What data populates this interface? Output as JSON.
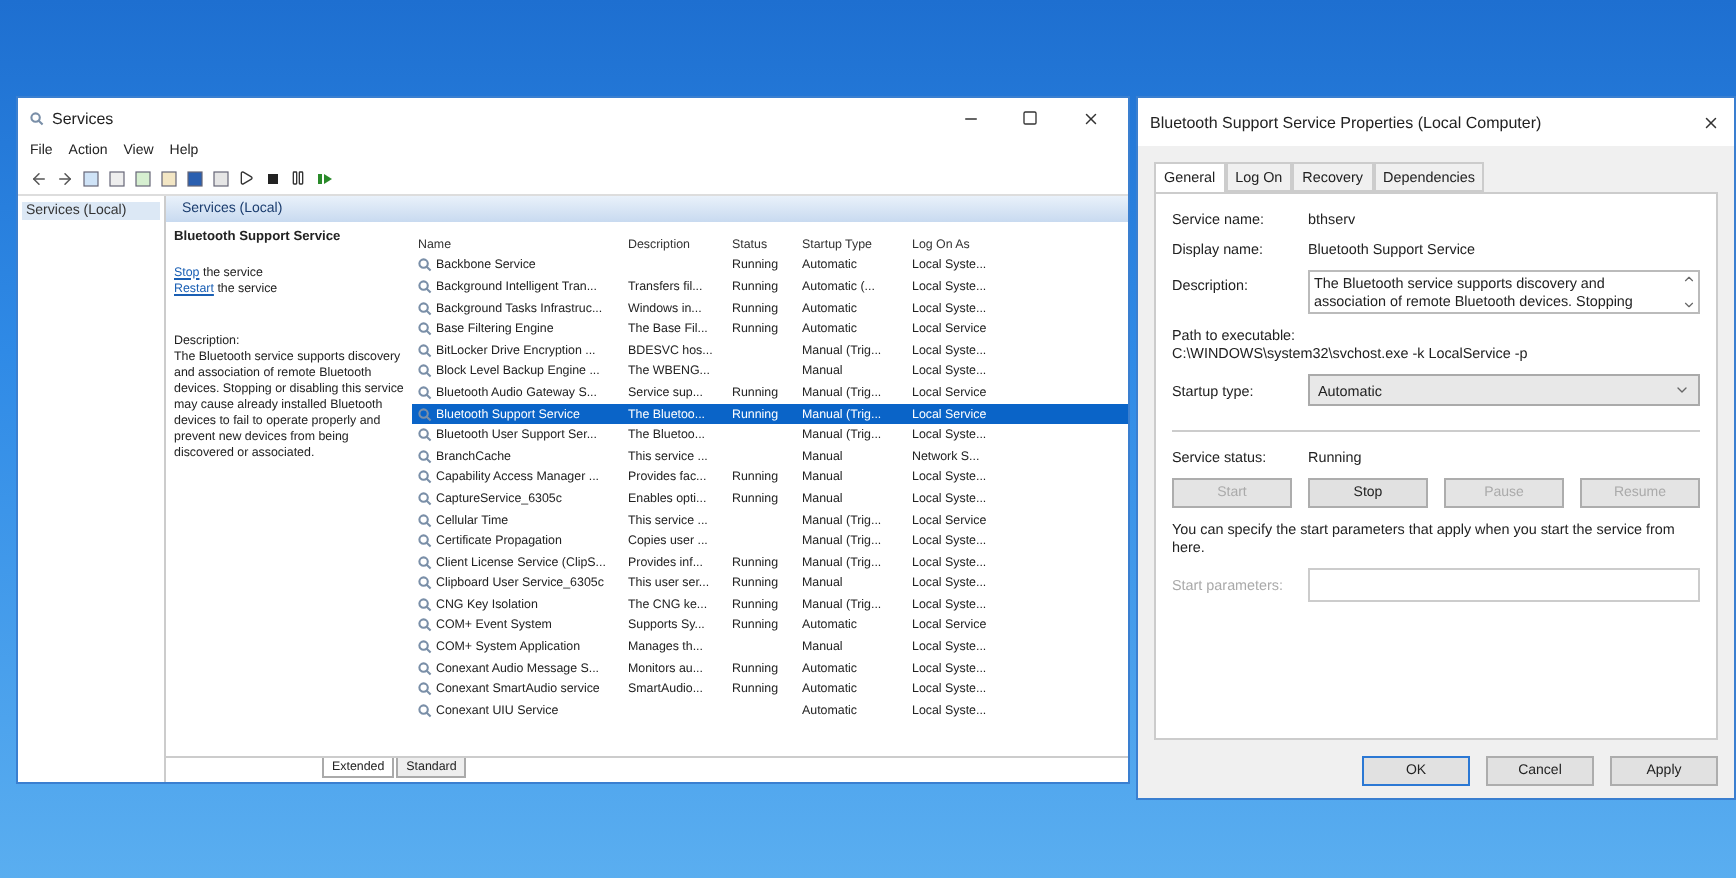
{
  "services_window": {
    "title": "Services",
    "menu": [
      "File",
      "Action",
      "View",
      "Help"
    ],
    "tree": [
      {
        "label": "Services (Local)",
        "selected": true
      }
    ],
    "header": "Services (Local)",
    "extended": {
      "service_title": "Bluetooth Support Service",
      "actions": [
        {
          "link": "Stop",
          "text": "the service"
        },
        {
          "link": "Restart",
          "text": "the service"
        }
      ],
      "description_label": "Description:",
      "description": "The Bluetooth service supports discovery and association of remote Bluetooth devices.  Stopping or disabling this service may cause already installed Bluetooth devices to fail to operate properly and prevent new devices from being discovered or associated."
    },
    "columns": [
      "Name",
      "Description",
      "Status",
      "Startup Type",
      "Log On As"
    ],
    "rows": [
      {
        "cells": [
          "Backbone Service",
          "",
          "Running",
          "Automatic",
          "Local Syste..."
        ],
        "selected": false
      },
      {
        "cells": [
          "Background Intelligent Tran...",
          "Transfers fil...",
          "Running",
          "Automatic (...",
          "Local Syste..."
        ],
        "selected": false
      },
      {
        "cells": [
          "Background Tasks Infrastruc...",
          "Windows in...",
          "Running",
          "Automatic",
          "Local Syste..."
        ],
        "selected": false
      },
      {
        "cells": [
          "Base Filtering Engine",
          "The Base Fil...",
          "Running",
          "Automatic",
          "Local Service"
        ],
        "selected": false
      },
      {
        "cells": [
          "BitLocker Drive Encryption ...",
          "BDESVC hos...",
          "",
          "Manual (Trig...",
          "Local Syste..."
        ],
        "selected": false
      },
      {
        "cells": [
          "Block Level Backup Engine ...",
          "The WBENG...",
          "",
          "Manual",
          "Local Syste..."
        ],
        "selected": false
      },
      {
        "cells": [
          "Bluetooth Audio Gateway S...",
          "Service sup...",
          "Running",
          "Manual (Trig...",
          "Local Service"
        ],
        "selected": false
      },
      {
        "cells": [
          "Bluetooth Support Service",
          "The Bluetoo...",
          "Running",
          "Manual (Trig...",
          "Local Service"
        ],
        "selected": true
      },
      {
        "cells": [
          "Bluetooth User Support Ser...",
          "The Bluetoo...",
          "",
          "Manual (Trig...",
          "Local Syste..."
        ],
        "selected": false
      },
      {
        "cells": [
          "BranchCache",
          "This service ...",
          "",
          "Manual",
          "Network S..."
        ],
        "selected": false
      },
      {
        "cells": [
          "Capability Access Manager ...",
          "Provides fac...",
          "Running",
          "Manual",
          "Local Syste..."
        ],
        "selected": false
      },
      {
        "cells": [
          "CaptureService_6305c",
          "Enables opti...",
          "Running",
          "Manual",
          "Local Syste..."
        ],
        "selected": false
      },
      {
        "cells": [
          "Cellular Time",
          "This service ...",
          "",
          "Manual (Trig...",
          "Local Service"
        ],
        "selected": false
      },
      {
        "cells": [
          "Certificate Propagation",
          "Copies user ...",
          "",
          "Manual (Trig...",
          "Local Syste..."
        ],
        "selected": false
      },
      {
        "cells": [
          "Client License Service (ClipS...",
          "Provides inf...",
          "Running",
          "Manual (Trig...",
          "Local Syste..."
        ],
        "selected": false
      },
      {
        "cells": [
          "Clipboard User Service_6305c",
          "This user ser...",
          "Running",
          "Manual",
          "Local Syste..."
        ],
        "selected": false
      },
      {
        "cells": [
          "CNG Key Isolation",
          "The CNG ke...",
          "Running",
          "Manual (Trig...",
          "Local Syste..."
        ],
        "selected": false
      },
      {
        "cells": [
          "COM+ Event System",
          "Supports Sy...",
          "Running",
          "Automatic",
          "Local Service"
        ],
        "selected": false
      },
      {
        "cells": [
          "COM+ System Application",
          "Manages th...",
          "",
          "Manual",
          "Local Syste..."
        ],
        "selected": false
      },
      {
        "cells": [
          "Conexant Audio Message S...",
          "Monitors au...",
          "Running",
          "Automatic",
          "Local Syste..."
        ],
        "selected": false
      },
      {
        "cells": [
          "Conexant SmartAudio service",
          "SmartAudio...",
          "Running",
          "Automatic",
          "Local Syste..."
        ],
        "selected": false
      },
      {
        "cells": [
          "Conexant UIU Service",
          "",
          "",
          "Automatic",
          "Local Syste..."
        ],
        "selected": false
      }
    ],
    "view_tabs": [
      {
        "label": "Extended",
        "selected": true
      },
      {
        "label": "Standard",
        "selected": false
      }
    ]
  },
  "properties_window": {
    "title": "Bluetooth Support Service Properties (Local Computer)",
    "tabs": [
      {
        "label": "General",
        "selected": true
      },
      {
        "label": "Log On",
        "selected": false
      },
      {
        "label": "Recovery",
        "selected": false
      },
      {
        "label": "Dependencies",
        "selected": false
      }
    ],
    "service_name_label": "Service name:",
    "service_name": "bthserv",
    "display_name_label": "Display name:",
    "display_name": "Bluetooth Support Service",
    "description_label": "Description:",
    "description": "The Bluetooth service supports discovery and association of remote Bluetooth devices.  Stopping",
    "path_label": "Path to executable:",
    "path": "C:\\WINDOWS\\system32\\svchost.exe -k LocalService -p",
    "startup_label": "Startup type:",
    "startup_value": "Automatic",
    "status_label": "Service status:",
    "status_value": "Running",
    "control_buttons": [
      {
        "label": "Start",
        "disabled": true
      },
      {
        "label": "Stop",
        "disabled": false
      },
      {
        "label": "Pause",
        "disabled": true
      },
      {
        "label": "Resume",
        "disabled": true
      }
    ],
    "hint": "You can specify the start parameters that apply when you start the service from here.",
    "params_label": "Start parameters:",
    "params_disabled": true,
    "buttons": [
      {
        "label": "OK",
        "default": true
      },
      {
        "label": "Cancel",
        "default": false
      },
      {
        "label": "Apply",
        "default": false
      }
    ]
  }
}
